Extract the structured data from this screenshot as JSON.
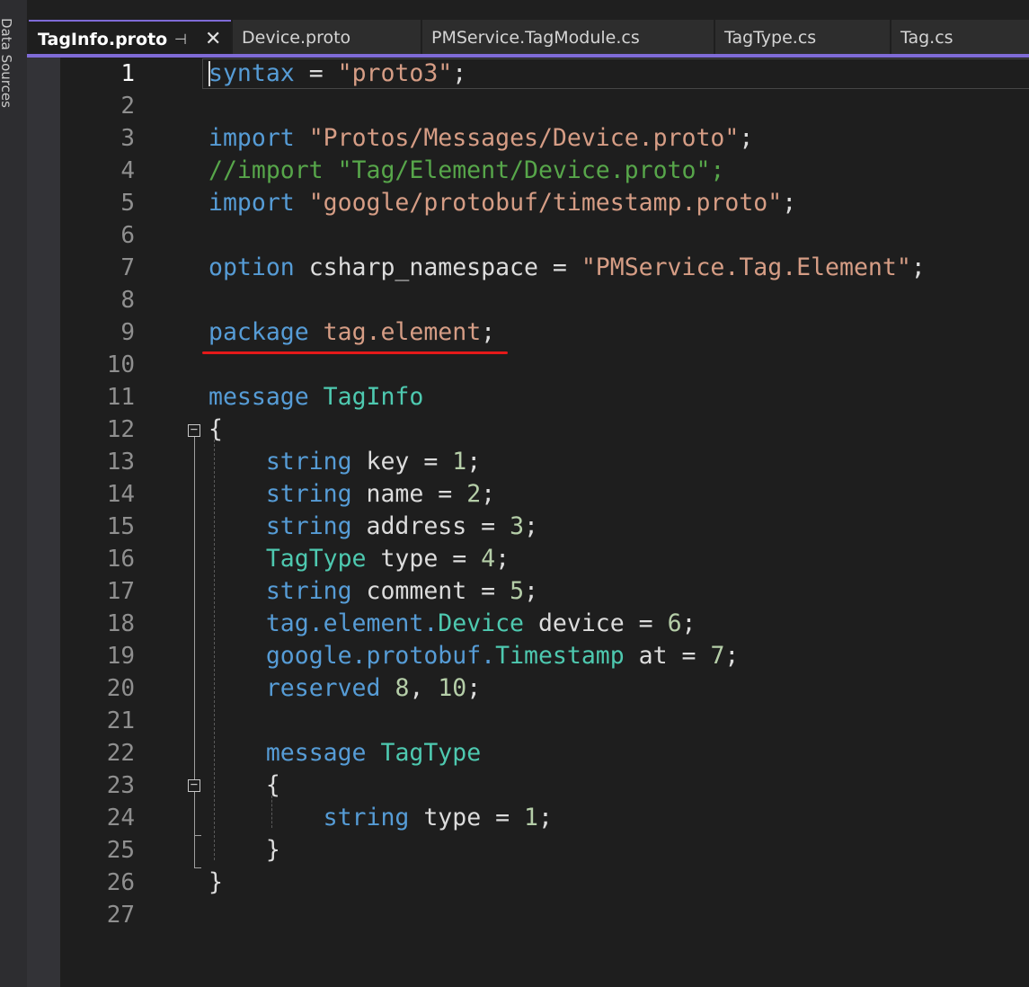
{
  "side_panel": {
    "label": "Data Sources"
  },
  "tabs": [
    {
      "label": "TagInfo.proto",
      "active": true
    },
    {
      "label": "Device.proto",
      "active": false
    },
    {
      "label": "PMService.TagModule.cs",
      "active": false
    },
    {
      "label": "TagType.cs",
      "active": false
    },
    {
      "label": "Tag.cs",
      "active": false
    }
  ],
  "tab_actions": {
    "pin": "⊣",
    "close": "✕"
  },
  "fold": {
    "collapse_symbol": "−"
  },
  "editor": {
    "current_line": 1,
    "lines": [
      {
        "n": "1",
        "tokens": [
          [
            "kw",
            "syntax"
          ],
          [
            "pl",
            " = "
          ],
          [
            "str",
            "\"proto3\""
          ],
          [
            "pl",
            ";"
          ]
        ]
      },
      {
        "n": "2",
        "tokens": []
      },
      {
        "n": "3",
        "tokens": [
          [
            "kw",
            "import"
          ],
          [
            "pl",
            " "
          ],
          [
            "str",
            "\"Protos/Messages/Device.proto\""
          ],
          [
            "pl",
            ";"
          ]
        ]
      },
      {
        "n": "4",
        "tokens": [
          [
            "cm",
            "//import \"Tag/Element/Device.proto\";"
          ]
        ]
      },
      {
        "n": "5",
        "tokens": [
          [
            "kw",
            "import"
          ],
          [
            "pl",
            " "
          ],
          [
            "str",
            "\"google/protobuf/timestamp.proto\""
          ],
          [
            "pl",
            ";"
          ]
        ]
      },
      {
        "n": "6",
        "tokens": []
      },
      {
        "n": "7",
        "tokens": [
          [
            "kw",
            "option"
          ],
          [
            "pl",
            " csharp_namespace = "
          ],
          [
            "str",
            "\"PMService.Tag.Element\""
          ],
          [
            "pl",
            ";"
          ]
        ]
      },
      {
        "n": "8",
        "tokens": []
      },
      {
        "n": "9",
        "tokens": [
          [
            "kw",
            "package"
          ],
          [
            "pl",
            " "
          ],
          [
            "ns",
            "tag.element"
          ],
          [
            "pl",
            ";"
          ]
        ]
      },
      {
        "n": "10",
        "tokens": []
      },
      {
        "n": "11",
        "tokens": [
          [
            "kw",
            "message"
          ],
          [
            "pl",
            " "
          ],
          [
            "tp",
            "TagInfo"
          ]
        ]
      },
      {
        "n": "12",
        "tokens": [
          [
            "pl",
            "{"
          ]
        ]
      },
      {
        "n": "13",
        "tokens": [
          [
            "pl",
            "    "
          ],
          [
            "kw",
            "string"
          ],
          [
            "pl",
            " key = "
          ],
          [
            "num",
            "1"
          ],
          [
            "pl",
            ";"
          ]
        ]
      },
      {
        "n": "14",
        "tokens": [
          [
            "pl",
            "    "
          ],
          [
            "kw",
            "string"
          ],
          [
            "pl",
            " name = "
          ],
          [
            "num",
            "2"
          ],
          [
            "pl",
            ";"
          ]
        ]
      },
      {
        "n": "15",
        "tokens": [
          [
            "pl",
            "    "
          ],
          [
            "kw",
            "string"
          ],
          [
            "pl",
            " address = "
          ],
          [
            "num",
            "3"
          ],
          [
            "pl",
            ";"
          ]
        ]
      },
      {
        "n": "16",
        "tokens": [
          [
            "pl",
            "    "
          ],
          [
            "tp",
            "TagType"
          ],
          [
            "pl",
            " type = "
          ],
          [
            "num",
            "4"
          ],
          [
            "pl",
            ";"
          ]
        ]
      },
      {
        "n": "17",
        "tokens": [
          [
            "pl",
            "    "
          ],
          [
            "kw",
            "string"
          ],
          [
            "pl",
            " comment = "
          ],
          [
            "num",
            "5"
          ],
          [
            "pl",
            ";"
          ]
        ]
      },
      {
        "n": "18",
        "tokens": [
          [
            "pl",
            "    "
          ],
          [
            "kw",
            "tag.element."
          ],
          [
            "tp",
            "Device"
          ],
          [
            "pl",
            " device = "
          ],
          [
            "num",
            "6"
          ],
          [
            "pl",
            ";"
          ]
        ]
      },
      {
        "n": "19",
        "tokens": [
          [
            "pl",
            "    "
          ],
          [
            "kw",
            "google.protobuf."
          ],
          [
            "tp",
            "Timestamp"
          ],
          [
            "pl",
            " at = "
          ],
          [
            "num",
            "7"
          ],
          [
            "pl",
            ";"
          ]
        ]
      },
      {
        "n": "20",
        "tokens": [
          [
            "pl",
            "    "
          ],
          [
            "kw",
            "reserved"
          ],
          [
            "pl",
            " "
          ],
          [
            "num",
            "8"
          ],
          [
            "pl",
            ", "
          ],
          [
            "num",
            "10"
          ],
          [
            "pl",
            ";"
          ]
        ]
      },
      {
        "n": "21",
        "tokens": []
      },
      {
        "n": "22",
        "tokens": [
          [
            "pl",
            "    "
          ],
          [
            "kw",
            "message"
          ],
          [
            "pl",
            " "
          ],
          [
            "tp",
            "TagType"
          ]
        ]
      },
      {
        "n": "23",
        "tokens": [
          [
            "pl",
            "    {"
          ]
        ]
      },
      {
        "n": "24",
        "tokens": [
          [
            "pl",
            "        "
          ],
          [
            "kw",
            "string"
          ],
          [
            "pl",
            " type = "
          ],
          [
            "num",
            "1"
          ],
          [
            "pl",
            ";"
          ]
        ]
      },
      {
        "n": "25",
        "tokens": [
          [
            "pl",
            "    }"
          ]
        ]
      },
      {
        "n": "26",
        "tokens": [
          [
            "pl",
            "}"
          ]
        ]
      },
      {
        "n": "27",
        "tokens": []
      }
    ]
  },
  "colors": {
    "keyword": "#569cd6",
    "string": "#d69d85",
    "comment": "#57a64a",
    "type": "#4ec9b0",
    "number": "#b5cea8",
    "plain": "#dcdcdc",
    "accent": "#7f6bd6",
    "annotation_underline": "#e51919"
  }
}
